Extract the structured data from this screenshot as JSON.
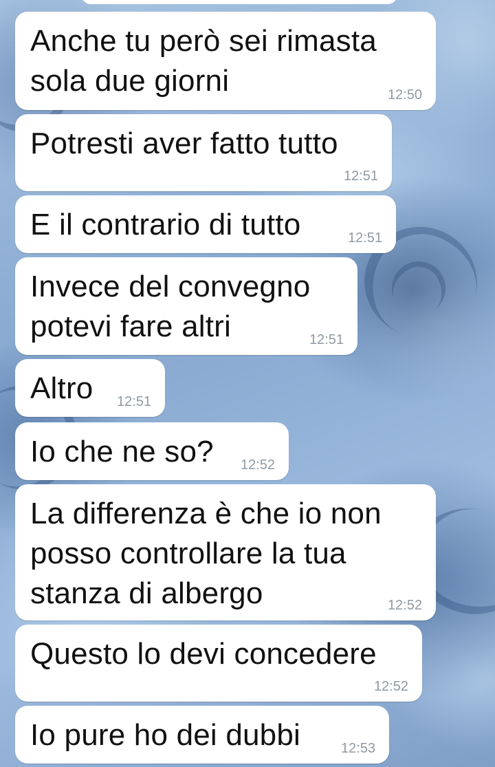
{
  "messages": [
    {
      "text": "Anche tu però sei rimasta\nsola due giorni",
      "time": "12:50"
    },
    {
      "text": "Potresti aver fatto tutto",
      "time": "12:51"
    },
    {
      "text": "E il contrario di tutto",
      "time": "12:51"
    },
    {
      "text": "Invece del convegno\npotevi fare altri",
      "time": "12:51"
    },
    {
      "text": "Altro",
      "time": "12:51"
    },
    {
      "text": "Io che ne so?",
      "time": "12:52"
    },
    {
      "text": "La differenza è che io non\nposso controllare la tua\nstanza di albergo",
      "time": "12:52"
    },
    {
      "text": "Questo lo devi concedere",
      "time": "12:52"
    },
    {
      "text": "Io pure ho dei dubbi",
      "time": "12:53"
    }
  ]
}
